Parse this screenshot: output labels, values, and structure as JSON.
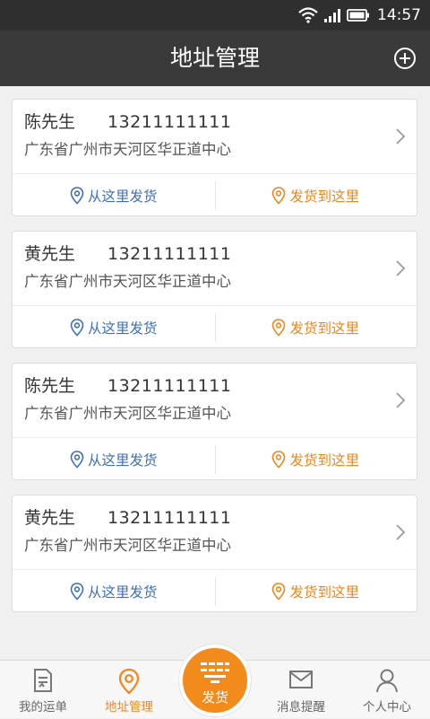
{
  "status_bar": {
    "time": "14:57"
  },
  "header": {
    "title": "地址管理"
  },
  "addresses": [
    {
      "name": "陈先生",
      "phone": "13211111111",
      "address": "广东省广州市天河区华正道中心"
    },
    {
      "name": "黄先生",
      "phone": "13211111111",
      "address": "广东省广州市天河区华正道中心"
    },
    {
      "name": "陈先生",
      "phone": "13211111111",
      "address": "广东省广州市天河区华正道中心"
    },
    {
      "name": "黄先生",
      "phone": "13211111111",
      "address": "广东省广州市天河区华正道中心"
    }
  ],
  "actions": {
    "ship_from": "从这里发货",
    "ship_to": "发货到这里"
  },
  "tabs": [
    {
      "label": "我的运单",
      "icon": "document-icon"
    },
    {
      "label": "地址管理",
      "icon": "location-pin-icon"
    },
    {
      "label": "发货",
      "icon": "ship-icon"
    },
    {
      "label": "消息提醒",
      "icon": "envelope-icon"
    },
    {
      "label": "个人中心",
      "icon": "person-icon"
    }
  ],
  "colors": {
    "accent": "#f08519",
    "link_blue": "#3d6fb6",
    "header_bg": "#3a3a3a",
    "status_bar_bg": "#2f2f2f"
  }
}
